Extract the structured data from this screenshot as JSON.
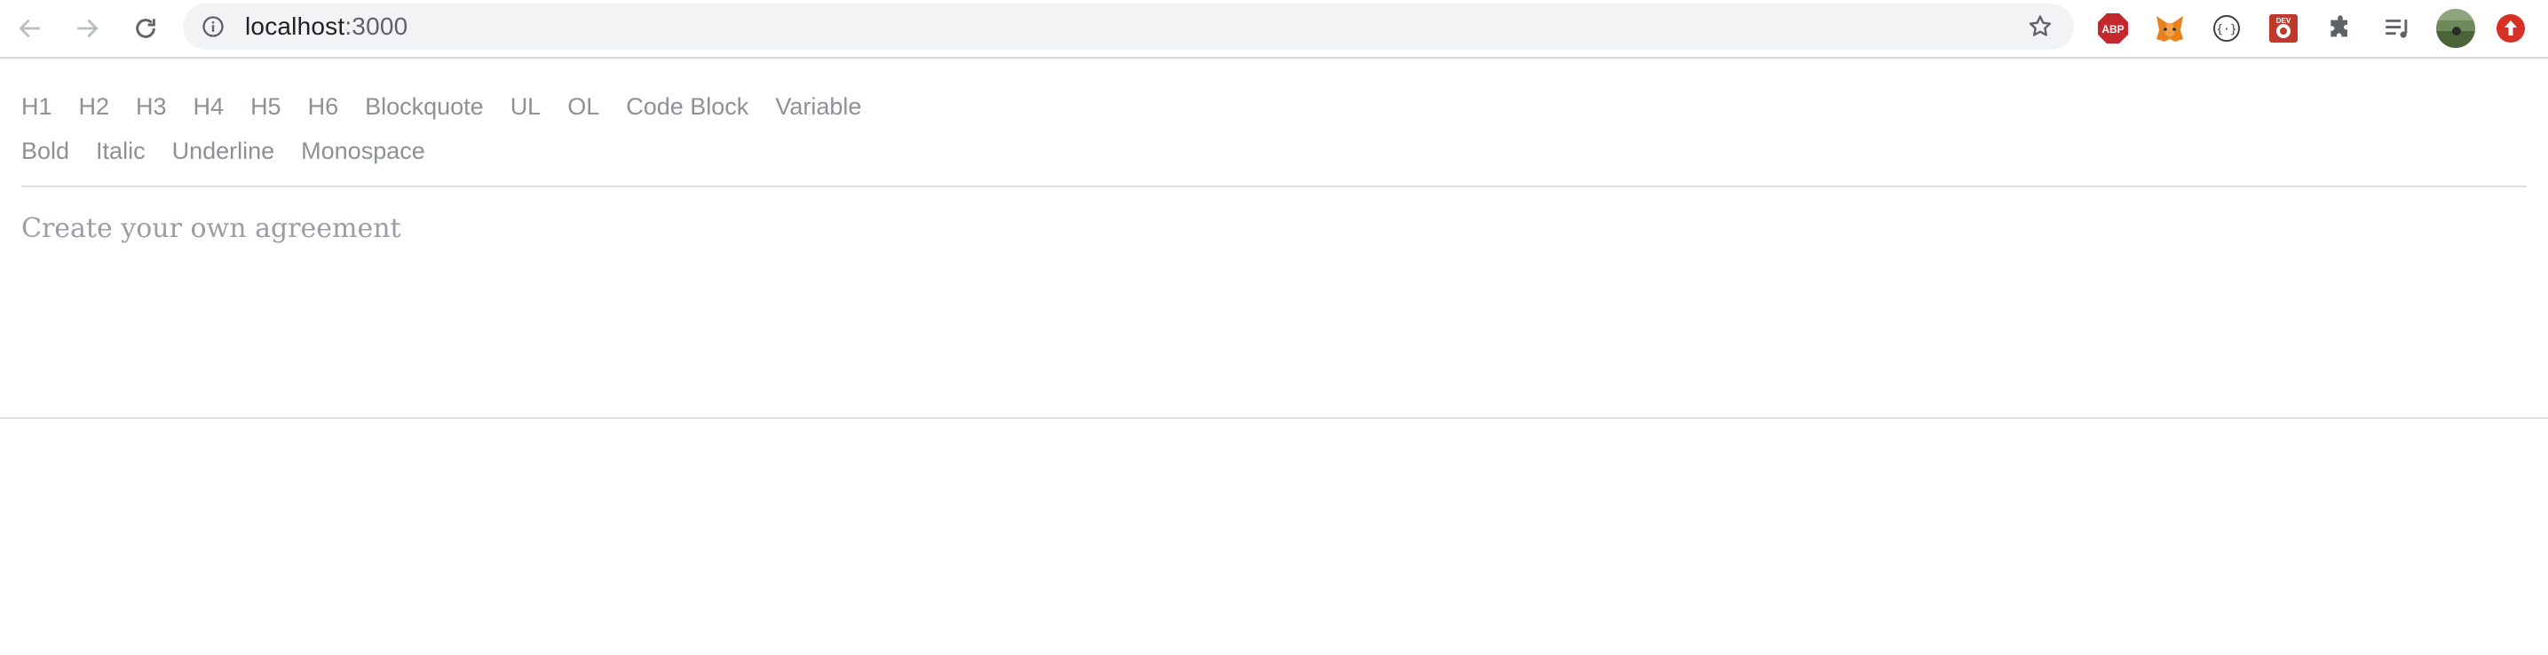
{
  "browser": {
    "url_host": "localhost",
    "url_port": ":3000",
    "extensions": [
      "adblock-plus-icon",
      "metamask-fox-icon",
      "braces-circle-icon",
      "bug-extension-icon",
      "puzzle-piece-icon",
      "reading-list-icon",
      "profile-avatar",
      "update-arrow-icon"
    ],
    "adblock_label": "ABP",
    "bug_ext_label": "DEV"
  },
  "toolbar": {
    "row1": [
      "H1",
      "H2",
      "H3",
      "H4",
      "H5",
      "H6",
      "Blockquote",
      "UL",
      "OL",
      "Code Block",
      "Variable"
    ],
    "row2": [
      "Bold",
      "Italic",
      "Underline",
      "Monospace"
    ]
  },
  "editor": {
    "placeholder": "Create your own agreement"
  },
  "colors": {
    "toolbar_text": "#8d9196",
    "placeholder_text": "#9a9ea4",
    "adblock_red": "#c3282c",
    "update_red": "#d93025"
  }
}
